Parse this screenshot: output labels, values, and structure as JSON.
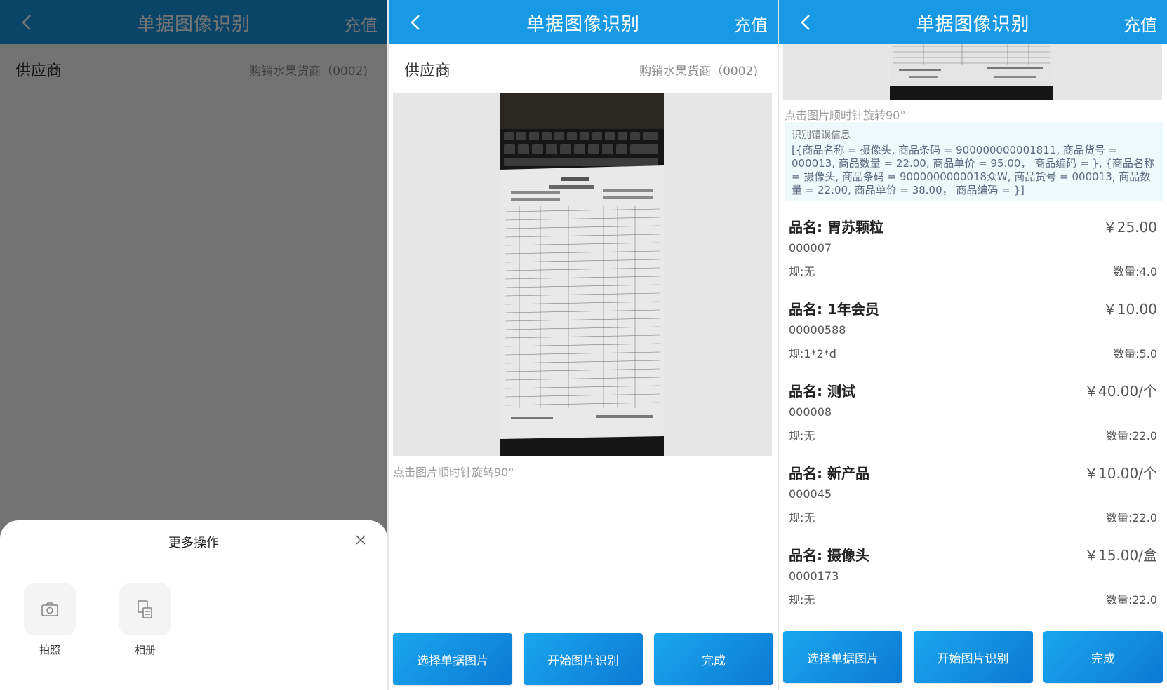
{
  "app": {
    "title": "单据图像识别",
    "recharge": "充值",
    "supplier_label": "供应商",
    "supplier_value": "购销水果货商（0002)"
  },
  "screen1": {
    "sheet_title": "更多操作",
    "actions": [
      {
        "label": "拍照",
        "icon": "camera-icon"
      },
      {
        "label": "相册",
        "icon": "album-icon"
      }
    ]
  },
  "screen2": {
    "rotate_hint": "点击图片顺时针旋转90°",
    "buttons": {
      "select": "选择单据图片",
      "start": "开始图片识别",
      "done": "完成"
    }
  },
  "screen3": {
    "rotate_hint": "点击图片顺时针旋转90°",
    "error_title": "识别错误信息",
    "error_text": "[{商品名称 = 摄像头, 商品条码 = 900000000001811, 商品货号 = 000013, 商品数量 = 22.00, 商品单价 = 95.00， 商品编码 = }, {商品名称 = 摄像头, 商品条码 = 9000000000018众W, 商品货号 = 000013, 商品数量 = 22.00, 商品单价 = 38.00， 商品编码 = }]",
    "goods": [
      {
        "name": "品名:  胃苏颗粒",
        "price": "￥25.00",
        "code": "000007",
        "spec": "规:无",
        "qty": "数量:4.0"
      },
      {
        "name": "品名:  1年会员",
        "price": "￥10.00",
        "code": "00000588",
        "spec": "规:1*2*d",
        "qty": "数量:5.0"
      },
      {
        "name": "品名:  测试",
        "price": "￥40.00/个",
        "code": "000008",
        "spec": "规:无",
        "qty": "数量:22.0"
      },
      {
        "name": "品名:  新产品",
        "price": "￥10.00/个",
        "code": "000045",
        "spec": "规:无",
        "qty": "数量:22.0"
      },
      {
        "name": "品名:  摄像头",
        "price": "￥15.00/盒",
        "code": "0000173",
        "spec": "规:无",
        "qty": "数量:22.0"
      }
    ],
    "buttons": {
      "select": "选择单据图片",
      "start": "开始图片识别",
      "done": "完成"
    }
  },
  "colors": {
    "primary": "#1899e6",
    "button_dark": "#0d79d2",
    "overlay": "#000000"
  }
}
